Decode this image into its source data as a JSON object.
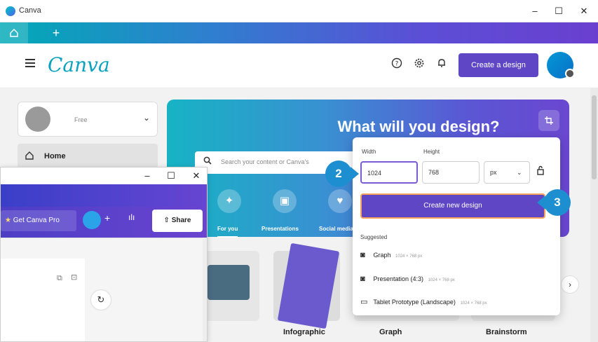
{
  "window": {
    "title": "Canva",
    "min": "–",
    "max": "☐",
    "close": "✕"
  },
  "tabs": {
    "home_icon": "home-icon",
    "add": "+"
  },
  "header": {
    "brand": "Canva",
    "help_icon": "⍰",
    "settings_icon": "⚙",
    "bell_icon": "🔔",
    "create_label": "Create a design"
  },
  "sidebar": {
    "plan": "Free",
    "chevron": "⌄",
    "home_label": "Home"
  },
  "hero": {
    "title": "What will you design?",
    "search_placeholder": "Search your content or Canva's",
    "resize_icon": "⌗"
  },
  "categories": [
    {
      "label": "For you",
      "icon": "✦"
    },
    {
      "label": "Presentations",
      "icon": "▣"
    },
    {
      "label": "Social media",
      "icon": "♥"
    }
  ],
  "cards": [
    {
      "label": "Infographic"
    },
    {
      "label": "Graph"
    },
    {
      "label": "Brainstorm"
    }
  ],
  "editor": {
    "min": "–",
    "max": "☐",
    "close": "✕",
    "get_pro": "Get Canva Pro",
    "plus": "+",
    "chart": "ılı",
    "share": "Share",
    "share_icon": "⇧",
    "refresh": "↻"
  },
  "popup": {
    "width_label": "Width",
    "height_label": "Height",
    "width_value": "1024",
    "height_value": "768",
    "unit": "px",
    "unit_chevron": "⌄",
    "lock_icon": "🔒",
    "create_new": "Create new design",
    "suggested_label": "Suggested",
    "suggestions": [
      {
        "name": "Graph",
        "dims": "1024 × 768 px"
      },
      {
        "name": "Presentation (4:3)",
        "dims": "1024 × 768 px"
      },
      {
        "name": "Tablet Prototype (Landscape)",
        "dims": "1024 × 768 px"
      }
    ]
  },
  "steps": {
    "two": "2",
    "three": "3"
  },
  "colors": {
    "accent": "#5e46c5",
    "brand": "#0aa2c0",
    "badge": "#1d8fd0"
  }
}
